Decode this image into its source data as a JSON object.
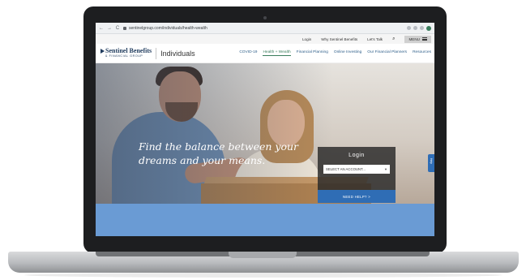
{
  "browser": {
    "url": "sentinelgroup.com/individuals/health-wealth",
    "back_glyph": "←",
    "forward_glyph": "→",
    "reload_glyph": "C"
  },
  "utility_nav": {
    "items": [
      "Login",
      "Why Sentinel Benefits",
      "Let's Talk"
    ],
    "search_glyph": "🔍",
    "menu_label": "MENU"
  },
  "site": {
    "logo_main": "Sentinel Benefits",
    "logo_sub": "& FINANCIAL GROUP",
    "section": "Individuals",
    "nav": [
      {
        "label": "COVID-19",
        "active": false
      },
      {
        "label": "Health + Wealth",
        "active": true
      },
      {
        "label": "Financial Planning",
        "active": false
      },
      {
        "label": "Online Investing",
        "active": false
      },
      {
        "label": "Our Financial Planners",
        "active": false
      },
      {
        "label": "Resources",
        "active": false
      }
    ]
  },
  "hero": {
    "tagline": "Find the balance between your dreams and your means."
  },
  "login": {
    "title": "Login",
    "select_placeholder": "SELECT AN ACCOUNT...",
    "help_button": "NEED HELP? >"
  },
  "side_tab": {
    "label": "Help"
  },
  "colors": {
    "brand_navy": "#1f3b5d",
    "link_blue": "#2f5f8a",
    "active_green": "#3a7d5c",
    "button_blue": "#2f6db5",
    "band_blue": "#6a9bd4"
  }
}
